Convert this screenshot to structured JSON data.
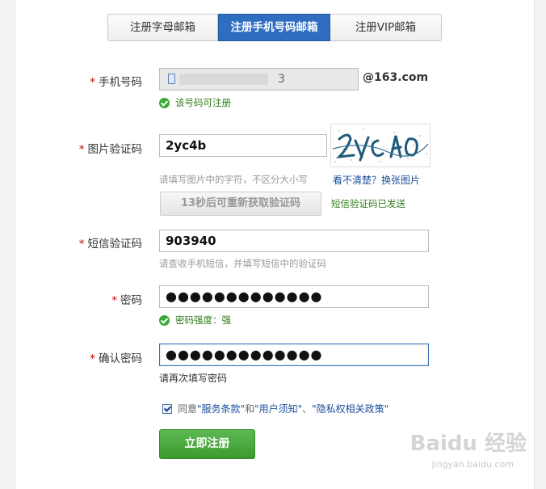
{
  "tabs": [
    {
      "label": "注册字母邮箱"
    },
    {
      "label": "注册手机号码邮箱"
    },
    {
      "label": "注册VIP邮箱"
    }
  ],
  "phone": {
    "label": "手机号码",
    "value_tail": "3",
    "suffix": "@163.com",
    "status": "该号码可注册"
  },
  "captcha": {
    "label": "图片验证码",
    "value": "2yc4b",
    "hint": "请填写图片中的字符，不区分大小写",
    "refresh_link": "看不清楚？换张图片"
  },
  "sms": {
    "resend_label": "13秒后可重新获取验证码",
    "sent_status": "短信验证码已发送",
    "label": "短信验证码",
    "value": "903940",
    "hint": "请查收手机短信，并填写短信中的验证码"
  },
  "password": {
    "label": "密码",
    "value": "●●●●●●●●●●●●●",
    "strength": "密码强度：强"
  },
  "confirm": {
    "label": "确认密码",
    "value": "●●●●●●●●●●●●●",
    "hint": "请再次填写密码"
  },
  "agreement": {
    "prefix": "同意",
    "term1": "\"服务条款\"",
    "and": "和",
    "term2": "\"用户须知\"",
    "sep": "、",
    "term3": "\"隐私权相关政策\""
  },
  "submit_label": "立即注册",
  "watermark": {
    "text": "Baidu 经验",
    "sub": "jingyan.baidu.com"
  }
}
